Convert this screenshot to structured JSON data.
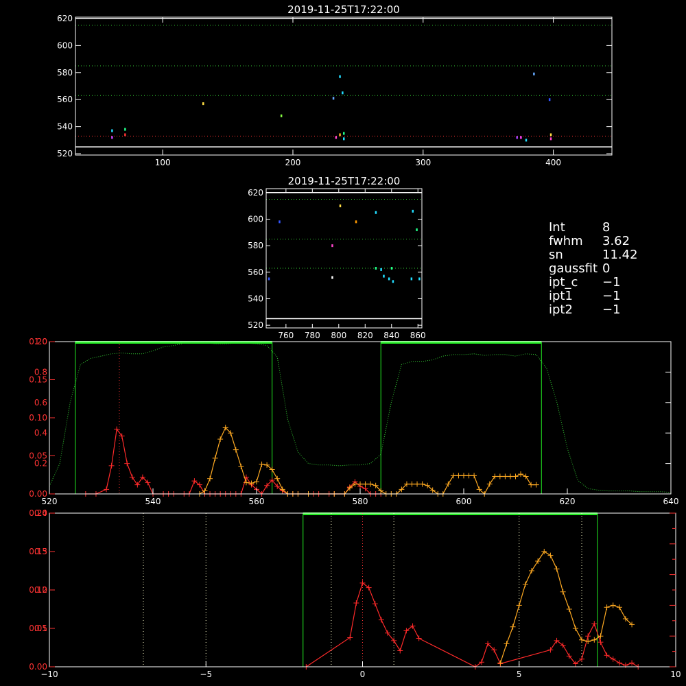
{
  "colors": {
    "background": "#000000",
    "axes": "#ffffff",
    "red": "#ff2a2a",
    "orange": "#ffaa22",
    "green": "#22ee22",
    "green_dotted": "#33cc33",
    "red_dotted": "#ff3333",
    "white_dotted": "#ffffcc",
    "axis_red": "#ff3333"
  },
  "info": [
    {
      "key": "Int",
      "value": "8"
    },
    {
      "key": "fwhm",
      "value": "3.62"
    },
    {
      "key": "sn",
      "value": "11.42"
    },
    {
      "key": "gaussfit",
      "value": "0"
    },
    {
      "key": "ipt_c",
      "value": "−1"
    },
    {
      "key": "ipt1",
      "value": "−1"
    },
    {
      "key": "ipt2",
      "value": "−1"
    }
  ],
  "chart_data": [
    {
      "type": "scatter",
      "title": "2019-11-25T17:22:00",
      "xlim": [
        33,
        445
      ],
      "ylim": [
        519,
        621
      ],
      "xticks": [
        100,
        200,
        300,
        400
      ],
      "yticks": [
        520,
        540,
        560,
        580,
        600,
        620
      ],
      "hlines": [
        {
          "y": 620,
          "color": "#ffffff",
          "style": "solid"
        },
        {
          "y": 615,
          "color": "#33cc33",
          "style": "dotted"
        },
        {
          "y": 585,
          "color": "#33cc33",
          "style": "dotted"
        },
        {
          "y": 563,
          "color": "#33cc33",
          "style": "dotted"
        },
        {
          "y": 533,
          "color": "#ff3333",
          "style": "dotted"
        },
        {
          "y": 525,
          "color": "#ffffff",
          "style": "solid"
        }
      ],
      "points": [
        {
          "x": 61,
          "y": 537,
          "color": "#22ddff"
        },
        {
          "x": 61,
          "y": 532,
          "color": "#cc44ff"
        },
        {
          "x": 71,
          "y": 538,
          "color": "#22ff88"
        },
        {
          "x": 71,
          "y": 534,
          "color": "#ff3333"
        },
        {
          "x": 131,
          "y": 557,
          "color": "#ffdd44"
        },
        {
          "x": 191,
          "y": 548,
          "color": "#88ff44"
        },
        {
          "x": 231,
          "y": 561,
          "color": "#66aaff"
        },
        {
          "x": 236,
          "y": 577,
          "color": "#22ddff"
        },
        {
          "x": 238,
          "y": 565,
          "color": "#22ddff"
        },
        {
          "x": 233,
          "y": 532,
          "color": "#ff44cc"
        },
        {
          "x": 236,
          "y": 534,
          "color": "#ffaa22"
        },
        {
          "x": 239,
          "y": 535,
          "color": "#22ff88"
        },
        {
          "x": 239,
          "y": 531,
          "color": "#22ddff"
        },
        {
          "x": 372,
          "y": 532,
          "color": "#aa44ff"
        },
        {
          "x": 375,
          "y": 532,
          "color": "#ff44ff"
        },
        {
          "x": 379,
          "y": 530,
          "color": "#22ddff"
        },
        {
          "x": 385,
          "y": 579,
          "color": "#66aaff"
        },
        {
          "x": 397,
          "y": 560,
          "color": "#3355ff"
        },
        {
          "x": 398,
          "y": 534,
          "color": "#ffdd44"
        },
        {
          "x": 398,
          "y": 531,
          "color": "#ff44cc"
        }
      ]
    },
    {
      "type": "scatter",
      "title": "2019-11-25T17:22:00",
      "xlim": [
        745,
        863
      ],
      "ylim": [
        518,
        623
      ],
      "xticks": [
        760,
        780,
        800,
        820,
        840,
        860
      ],
      "yticks": [
        520,
        540,
        560,
        580,
        600,
        620
      ],
      "hlines": [
        {
          "y": 620,
          "color": "#ffffff",
          "style": "solid"
        },
        {
          "y": 615,
          "color": "#33cc33",
          "style": "dotted"
        },
        {
          "y": 585,
          "color": "#33cc33",
          "style": "dotted"
        },
        {
          "y": 563,
          "color": "#33cc33",
          "style": "dotted"
        },
        {
          "y": 525,
          "color": "#ffffff",
          "style": "solid"
        }
      ],
      "points": [
        {
          "x": 755,
          "y": 598,
          "color": "#3355ff"
        },
        {
          "x": 747,
          "y": 555,
          "color": "#3355ff"
        },
        {
          "x": 795,
          "y": 580,
          "color": "#ff44cc"
        },
        {
          "x": 795,
          "y": 556,
          "color": "#ffffff"
        },
        {
          "x": 801,
          "y": 610,
          "color": "#ffdd44"
        },
        {
          "x": 813,
          "y": 598,
          "color": "#ff9900"
        },
        {
          "x": 828,
          "y": 605,
          "color": "#22ddff"
        },
        {
          "x": 828,
          "y": 563,
          "color": "#22ff88"
        },
        {
          "x": 832,
          "y": 562,
          "color": "#22ddff"
        },
        {
          "x": 834,
          "y": 557,
          "color": "#22ddff"
        },
        {
          "x": 838,
          "y": 555,
          "color": "#22ddff"
        },
        {
          "x": 840,
          "y": 563,
          "color": "#22ff88"
        },
        {
          "x": 841,
          "y": 553,
          "color": "#22ddff"
        },
        {
          "x": 856,
          "y": 606,
          "color": "#22ddff"
        },
        {
          "x": 855,
          "y": 555,
          "color": "#22ddff"
        },
        {
          "x": 859,
          "y": 592,
          "color": "#22ff88"
        },
        {
          "x": 861,
          "y": 555,
          "color": "#22ddff"
        }
      ]
    },
    {
      "type": "line",
      "xlim": [
        520,
        640
      ],
      "ylim": [
        0,
        0.2
      ],
      "xticks": [
        520,
        540,
        560,
        580,
        600,
        620,
        640
      ],
      "yticks_left": [
        0.0,
        0.05,
        0.1,
        0.15,
        0.2
      ],
      "yticks_left_labels": [
        "0.00",
        "0.05",
        "0.10",
        "0.15",
        "0.20"
      ],
      "yticks_left2": [
        "0.0",
        "0.2",
        "0.4",
        "0.6",
        "0.8",
        "1.0"
      ],
      "box_fills": [
        {
          "x0": 525,
          "x1": 563,
          "top": 0.2
        },
        {
          "x0": 584,
          "x1": 615,
          "top": 0.2
        }
      ],
      "vline_red_dotted": 533.5,
      "series": [
        {
          "color": "#ff2a2a",
          "x": [
            527,
            529,
            531,
            532,
            533,
            534,
            535,
            536,
            537,
            538,
            539,
            540,
            542,
            543,
            544,
            546,
            547,
            548,
            549,
            550,
            551,
            552,
            553,
            554,
            555,
            556,
            557,
            558,
            559,
            560,
            561,
            562,
            563,
            564,
            565,
            566,
            567,
            568,
            570,
            571,
            572,
            574,
            575,
            577,
            578,
            579,
            580,
            581,
            582,
            583,
            584
          ],
          "y": [
            0,
            0,
            0.006,
            0.037,
            0.085,
            0.076,
            0.04,
            0.022,
            0.012,
            0.022,
            0.015,
            0,
            0,
            0,
            0,
            0,
            0,
            0.017,
            0.012,
            0,
            0,
            0,
            0,
            0,
            0,
            0,
            0,
            0.022,
            0.012,
            0.006,
            0,
            0.011,
            0.018,
            0.01,
            0.004,
            0,
            0,
            0,
            0,
            0,
            0,
            0,
            0,
            0,
            0.009,
            0.016,
            0.01,
            0.007,
            0,
            0,
            0
          ]
        },
        {
          "color": "#ffaa22",
          "x": [
            549,
            550,
            551,
            552,
            553,
            554,
            555,
            556,
            557,
            558,
            559,
            560,
            561,
            562,
            563,
            564,
            565,
            566,
            567,
            568,
            570,
            575,
            577,
            578,
            579,
            580,
            581,
            582,
            583,
            584,
            585,
            586,
            587,
            588,
            589,
            590,
            591,
            592,
            593,
            594,
            595,
            596,
            597,
            598,
            599,
            600,
            601,
            602,
            603,
            604,
            605,
            606,
            607,
            608,
            609,
            610,
            611,
            612,
            613,
            614
          ],
          "y": [
            0,
            0.004,
            0.02,
            0.047,
            0.072,
            0.087,
            0.08,
            0.058,
            0.036,
            0.015,
            0.014,
            0.016,
            0.039,
            0.038,
            0.032,
            0.02,
            0.006,
            0,
            0,
            0,
            0,
            0,
            0,
            0.008,
            0.013,
            0.013,
            0.013,
            0.013,
            0.011,
            0.004,
            0,
            0,
            0,
            0.006,
            0.013,
            0.013,
            0.013,
            0.013,
            0.011,
            0.005,
            0,
            0,
            0.013,
            0.024,
            0.024,
            0.024,
            0.024,
            0.024,
            0.006,
            0,
            0.013,
            0.023,
            0.023,
            0.023,
            0.023,
            0.023,
            0.026,
            0.023,
            0.012,
            0.012
          ]
        }
      ],
      "green_dotted": {
        "x": [
          520,
          522,
          524,
          526,
          528,
          530,
          532,
          534,
          536,
          538,
          540,
          542,
          544,
          546,
          548,
          550,
          552,
          554,
          556,
          558,
          560,
          562,
          564,
          566,
          568,
          570,
          572,
          574,
          576,
          578,
          580,
          582,
          584,
          586,
          588,
          590,
          592,
          594,
          596,
          598,
          600,
          602,
          604,
          606,
          608,
          610,
          612,
          614,
          616,
          618,
          620,
          622,
          624,
          626,
          628,
          630,
          632,
          634,
          636,
          638,
          640
        ],
        "y": [
          0.01,
          0.04,
          0.12,
          0.17,
          0.178,
          0.181,
          0.184,
          0.185,
          0.184,
          0.184,
          0.188,
          0.193,
          0.195,
          0.198,
          0.199,
          0.199,
          0.197,
          0.197,
          0.198,
          0.198,
          0.197,
          0.195,
          0.18,
          0.098,
          0.055,
          0.04,
          0.038,
          0.038,
          0.037,
          0.038,
          0.038,
          0.04,
          0.052,
          0.12,
          0.17,
          0.174,
          0.174,
          0.176,
          0.181,
          0.183,
          0.183,
          0.184,
          0.182,
          0.183,
          0.183,
          0.181,
          0.184,
          0.183,
          0.165,
          0.12,
          0.06,
          0.018,
          0.007,
          0.005,
          0.004,
          0.004,
          0.004,
          0.003,
          0.003,
          0.003,
          0.002
        ]
      }
    },
    {
      "type": "line",
      "xlim": [
        -10,
        10
      ],
      "ylim": [
        0,
        0.2
      ],
      "xticks": [
        -10,
        -5,
        0,
        5,
        10
      ],
      "xtick_labels": [
        "−10",
        "−5",
        "0",
        "5",
        "10"
      ],
      "yticks_left_labels": [
        "0.00",
        "0.05",
        "0.10",
        "0.15",
        "0.20"
      ],
      "yticks_left2": [
        "0.0",
        "0.1",
        "0.2",
        "0.3",
        "0.4"
      ],
      "box_fill": {
        "x0": -1.9,
        "x1": 7.5,
        "top": 0.2
      },
      "vlines_white_dotted": [
        -7,
        -5,
        -1,
        1,
        5,
        7
      ],
      "vline_red_dotted": 0,
      "series": [
        {
          "color": "#ff2a2a",
          "x": [
            -1.8,
            -0.4,
            -0.2,
            0,
            0.2,
            0.4,
            0.6,
            0.8,
            1.0,
            1.2,
            1.4,
            1.6,
            1.8,
            3.6,
            3.8,
            4.0,
            4.2,
            4.4,
            6.0,
            6.2,
            6.4,
            6.6,
            6.8,
            7.0,
            7.2,
            7.4,
            7.6,
            7.8,
            8.0,
            8.2,
            8.4,
            8.6,
            8.8
          ],
          "y": [
            0,
            0.038,
            0.083,
            0.109,
            0.103,
            0.082,
            0.061,
            0.044,
            0.034,
            0.021,
            0.047,
            0.053,
            0.037,
            0,
            0.006,
            0.03,
            0.022,
            0.004,
            0.022,
            0.034,
            0.028,
            0.014,
            0.004,
            0.01,
            0.04,
            0.056,
            0.032,
            0.015,
            0.01,
            0.005,
            0.002,
            0.005,
            0
          ]
        },
        {
          "color": "#ffaa22",
          "x": [
            4.4,
            4.6,
            4.8,
            5.0,
            5.2,
            5.4,
            5.6,
            5.8,
            6.0,
            6.2,
            6.4,
            6.6,
            6.8,
            7.0,
            7.2,
            7.4,
            7.6,
            7.8,
            8.0,
            8.2,
            8.4,
            8.6
          ],
          "y": [
            0.01,
            0.06,
            0.104,
            0.16,
            0.215,
            0.25,
            0.275,
            0.3,
            0.29,
            0.255,
            0.195,
            0.15,
            0.1,
            0.07,
            0.066,
            0.07,
            0.08,
            0.155,
            0.16,
            0.155,
            0.125,
            0.11
          ]
        }
      ]
    }
  ]
}
